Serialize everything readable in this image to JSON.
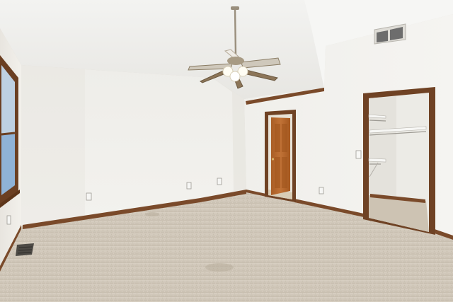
{
  "scene": {
    "description_free": true,
    "colors": {
      "ceiling": "#f2f1ee",
      "wall_left": "#efede8",
      "wall_back": "#f3f2ee",
      "wall_right": "#f1f0ec",
      "carpet": "#cfc6b8",
      "wood_trim": "#7a4a2a",
      "door": "#b5682d",
      "closet_wall": "#ecebe6",
      "window_glass": "#8fb2d6",
      "fan_metal": "#9a8f7d",
      "fan_blade": "#cfc8bb"
    },
    "icons": {
      "ceiling_fan": "ceiling-fan-icon",
      "vent": "air-vent-icon",
      "outlet": "power-outlet-icon",
      "switch": "light-switch-icon"
    }
  }
}
